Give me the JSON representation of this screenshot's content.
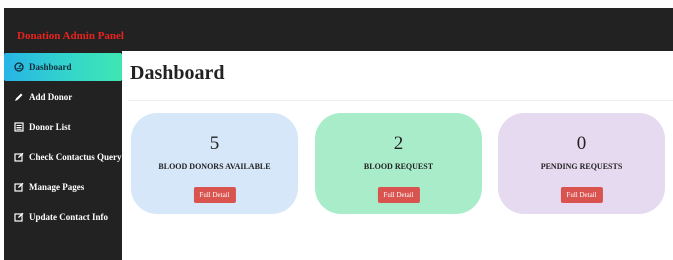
{
  "app": {
    "brand": "Donation Admin Panel"
  },
  "sidebar": {
    "items": [
      {
        "label": "Dashboard",
        "icon": "dashboard-icon",
        "active": true
      },
      {
        "label": "Add Donor",
        "icon": "pencil-icon"
      },
      {
        "label": "Donor List",
        "icon": "list-icon"
      },
      {
        "label": "Check Contactus Query",
        "icon": "edit-icon"
      },
      {
        "label": "Manage Pages",
        "icon": "edit-icon"
      },
      {
        "label": "Update Contact Info",
        "icon": "edit-icon"
      }
    ]
  },
  "main": {
    "title": "Dashboard",
    "cards": [
      {
        "count": "5",
        "label": "BLOOD DONORS AVAILABLE",
        "button": "Full Detail",
        "color": "#d5e7f8"
      },
      {
        "count": "2",
        "label": "BLOOD REQUEST",
        "button": "Full Detail",
        "color": "#a9ecca"
      },
      {
        "count": "0",
        "label": "PENDING REQUESTS",
        "button": "Full Detail",
        "color": "#e6daf0"
      }
    ]
  },
  "colors": {
    "topbar": "#222222",
    "brand_text": "#e8231f",
    "active_gradient_start": "#27b4e6",
    "active_gradient_end": "#3fe6b2",
    "button": "#d9534f"
  }
}
